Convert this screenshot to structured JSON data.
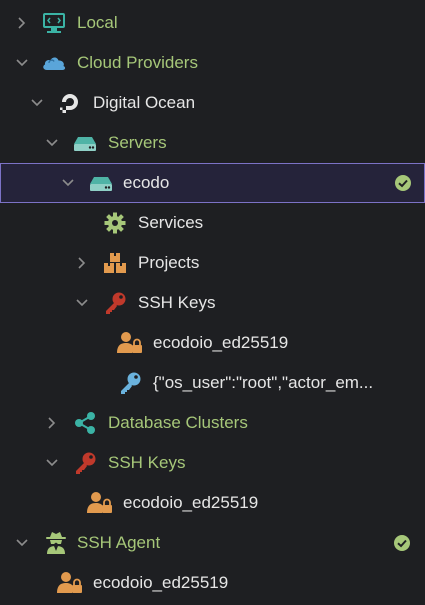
{
  "tree": {
    "local": "Local",
    "cloud_providers": "Cloud Providers",
    "digital_ocean": "Digital Ocean",
    "servers": "Servers",
    "ecodo": "ecodo",
    "services": "Services",
    "projects": "Projects",
    "ssh_keys_server": "SSH Keys",
    "server_key_1": "ecodoio_ed25519",
    "server_key_2": "{\"os_user\":\"root\",\"actor_em...",
    "database_clusters": "Database Clusters",
    "ssh_keys_provider": "SSH Keys",
    "provider_key_1": "ecodoio_ed25519",
    "ssh_agent": "SSH Agent",
    "agent_key_1": "ecodoio_ed25519"
  },
  "colors": {
    "background": "#1e1f22",
    "group_label": "#a6c779",
    "item_label": "#e6e6e6",
    "selection_border": "#7c72c6",
    "status_ok": "#a6c779",
    "key_orange": "#e29a4e",
    "key_red": "#c0392b",
    "key_blue": "#6ab2dd",
    "cloud_blue": "#5aa5d9",
    "teal": "#3bb3a5"
  }
}
